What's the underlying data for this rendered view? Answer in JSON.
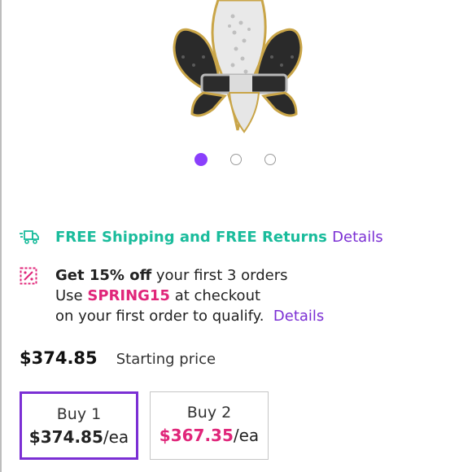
{
  "product": {
    "image_alt": "Fleur-de-lis pendant with black and white diamonds in gold and silver"
  },
  "carousel": {
    "active_index": 0,
    "total": 3,
    "active_color": "#8a3ffc"
  },
  "shipping": {
    "icon": "delivery-truck-icon",
    "text": "FREE Shipping and FREE Returns",
    "link": "Details",
    "color": "#1abc9c"
  },
  "promo": {
    "icon": "discount-tag-icon",
    "headline_bold": "Get 15% off",
    "headline_rest": " your first 3 orders",
    "use_prefix": "Use ",
    "code": "SPRING15",
    "use_suffix": " at checkout",
    "qualify_text": "on your first order to qualify.",
    "link": "Details",
    "code_color": "#e0267a"
  },
  "pricing": {
    "price": "$374.85",
    "label": "Starting price"
  },
  "buy_options": [
    {
      "title": "Buy 1",
      "price": "$374.85",
      "unit": "/ea",
      "selected": true
    },
    {
      "title": "Buy 2",
      "price": "$367.35",
      "unit": "/ea",
      "selected": false
    }
  ],
  "accent_color": "#7b2fd4"
}
